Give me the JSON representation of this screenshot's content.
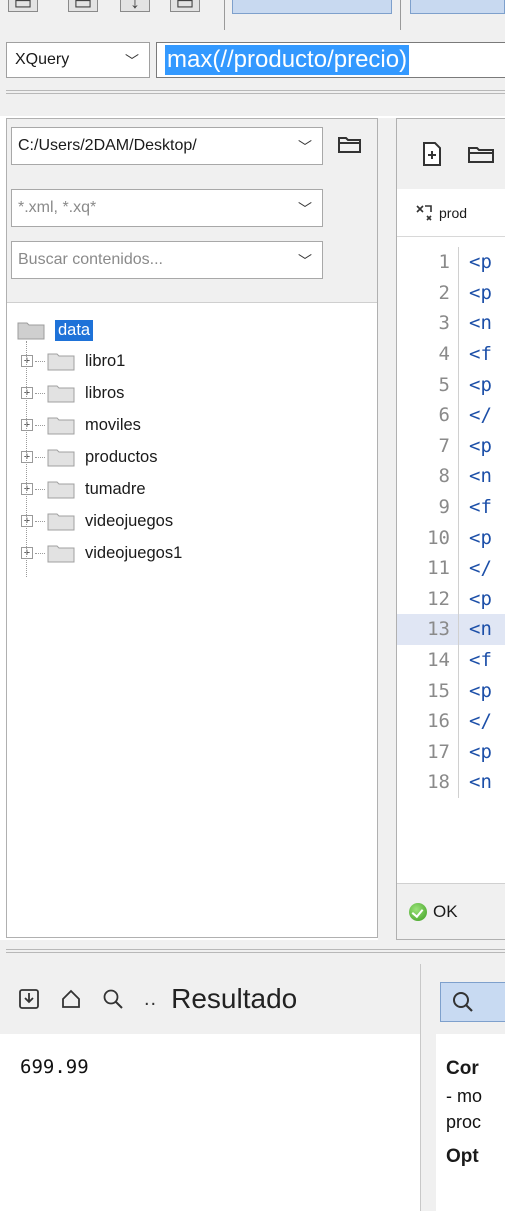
{
  "query": {
    "mode": "XQuery",
    "expression": "max(//producto/precio)"
  },
  "explorer": {
    "path": "C:/Users/2DAM/Desktop/",
    "filter_value": "*.xml, *.xq*",
    "search_placeholder": "Buscar contenidos...",
    "tree": {
      "root": "data",
      "children": [
        "libro1",
        "libros",
        "moviles",
        "productos",
        "tumadre",
        "videojuegos",
        "videojuegos1"
      ]
    }
  },
  "editor": {
    "tab_label": "prod",
    "lines": [
      {
        "n": "1",
        "t": "<p"
      },
      {
        "n": "2",
        "t": "<p"
      },
      {
        "n": "3",
        "t": "<n"
      },
      {
        "n": "4",
        "t": "<f"
      },
      {
        "n": "5",
        "t": "<p"
      },
      {
        "n": "6",
        "t": "</"
      },
      {
        "n": "7",
        "t": "<p"
      },
      {
        "n": "8",
        "t": "<n"
      },
      {
        "n": "9",
        "t": "<f"
      },
      {
        "n": "10",
        "t": "<p"
      },
      {
        "n": "11",
        "t": "</"
      },
      {
        "n": "12",
        "t": "<p"
      },
      {
        "n": "13",
        "t": "<n"
      },
      {
        "n": "14",
        "t": "<f"
      },
      {
        "n": "15",
        "t": "<p"
      },
      {
        "n": "16",
        "t": "</"
      },
      {
        "n": "17",
        "t": "<p"
      },
      {
        "n": "18",
        "t": "<n"
      }
    ],
    "highlighted_line": "13",
    "status": "OK"
  },
  "result": {
    "title": "Resultado",
    "ellipsis": "..",
    "value": "699.99"
  },
  "info": {
    "heading1": "Cor",
    "line1": "- mo",
    "line2": "proc",
    "heading2": "Opt"
  }
}
